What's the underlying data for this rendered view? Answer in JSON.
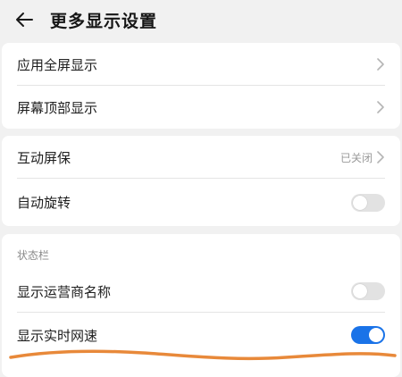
{
  "header": {
    "back_icon": "arrow-left-icon",
    "title": "更多显示设置"
  },
  "group1": {
    "items": [
      {
        "label": "应用全屏显示",
        "icon": "chevron-right-icon"
      },
      {
        "label": "屏幕顶部显示",
        "icon": "chevron-right-icon"
      }
    ]
  },
  "group2": {
    "items": [
      {
        "label": "互动屏保",
        "value": "已关闭",
        "icon": "chevron-right-icon"
      },
      {
        "label": "自动旋转",
        "toggle": "off"
      }
    ]
  },
  "group3": {
    "section_title": "状态栏",
    "items": [
      {
        "label": "显示运营商名称",
        "toggle": "off"
      },
      {
        "label": "显示实时网速",
        "toggle": "on"
      }
    ]
  },
  "colors": {
    "accent": "#1a73e8",
    "annotation": "#e8893a",
    "background": "#f1f1f1"
  }
}
